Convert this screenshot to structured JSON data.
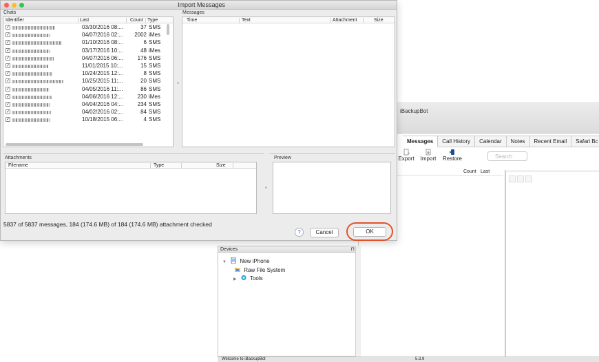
{
  "dialog": {
    "title": "Import Messages",
    "chats_label": "Chats",
    "chats_columns": {
      "identifier": "Identifier",
      "last": "Last",
      "count": "Count",
      "type": "Type"
    },
    "chats": [
      {
        "checked": true,
        "last": "03/30/2016 08:...",
        "count": "37",
        "type": "SMS"
      },
      {
        "checked": true,
        "last": "04/07/2016 02:...",
        "count": "2002",
        "type": "iMes"
      },
      {
        "checked": true,
        "last": "01/10/2016 08:...",
        "count": "6",
        "type": "SMS"
      },
      {
        "checked": true,
        "last": "03/17/2016 10:...",
        "count": "48",
        "type": "iMes"
      },
      {
        "checked": true,
        "last": "04/07/2016 06:...",
        "count": "176",
        "type": "SMS"
      },
      {
        "checked": true,
        "last": "11/01/2015 10:...",
        "count": "15",
        "type": "SMS"
      },
      {
        "checked": true,
        "last": "10/24/2015 12:...",
        "count": "8",
        "type": "SMS"
      },
      {
        "checked": true,
        "last": "10/25/2015 11:...",
        "count": "20",
        "type": "SMS"
      },
      {
        "checked": true,
        "last": "04/05/2016 11:...",
        "count": "86",
        "type": "SMS"
      },
      {
        "checked": true,
        "last": "04/06/2016 12:...",
        "count": "230",
        "type": "iMes"
      },
      {
        "checked": true,
        "last": "04/04/2016 04:...",
        "count": "234",
        "type": "SMS"
      },
      {
        "checked": true,
        "last": "04/02/2016 02:...",
        "count": "84",
        "type": "SMS"
      },
      {
        "checked": true,
        "last": "10/18/2015 06:...",
        "count": "4",
        "type": "SMS"
      }
    ],
    "messages_label": "Messages",
    "messages_columns": {
      "time": "Time",
      "text": "Text",
      "attachment": "Attachment",
      "size": "Size"
    },
    "attachments_label": "Attachments",
    "attachments_columns": {
      "filename": "Filename",
      "type": "Type",
      "size": "Size"
    },
    "preview_label": "Preview",
    "status": "5837 of 5837 messages, 184 (174.6 MB) of 184 (174.6 MB) attachment checked",
    "help_label": "?",
    "cancel_label": "Cancel",
    "ok_label": "OK"
  },
  "ibackupbot": {
    "title": "iBackupBot",
    "tabs": [
      "Messages",
      "Call History",
      "Calendar",
      "Notes",
      "Recent Email",
      "Safari Bc"
    ],
    "toolbar": {
      "export": "Export",
      "import": "Import",
      "restore": "Restore",
      "search_placeholder": "Search"
    },
    "list_columns": {
      "count": "Count",
      "last": "Last"
    }
  },
  "devices": {
    "title": "Devices",
    "tree": [
      {
        "label": "New iPhone",
        "icon": "iphone-icon"
      },
      {
        "label": "Raw File System",
        "icon": "folder-icon"
      },
      {
        "label": "Tools",
        "icon": "tools-icon"
      }
    ]
  },
  "statusbar": {
    "left": "Welcome to iBackupBot",
    "version": "5.3.9"
  },
  "colors": {
    "accent_ring": "#e0532a",
    "close": "#fc5f57",
    "minimize": "#fdbc2e",
    "zoom": "#33c748"
  }
}
